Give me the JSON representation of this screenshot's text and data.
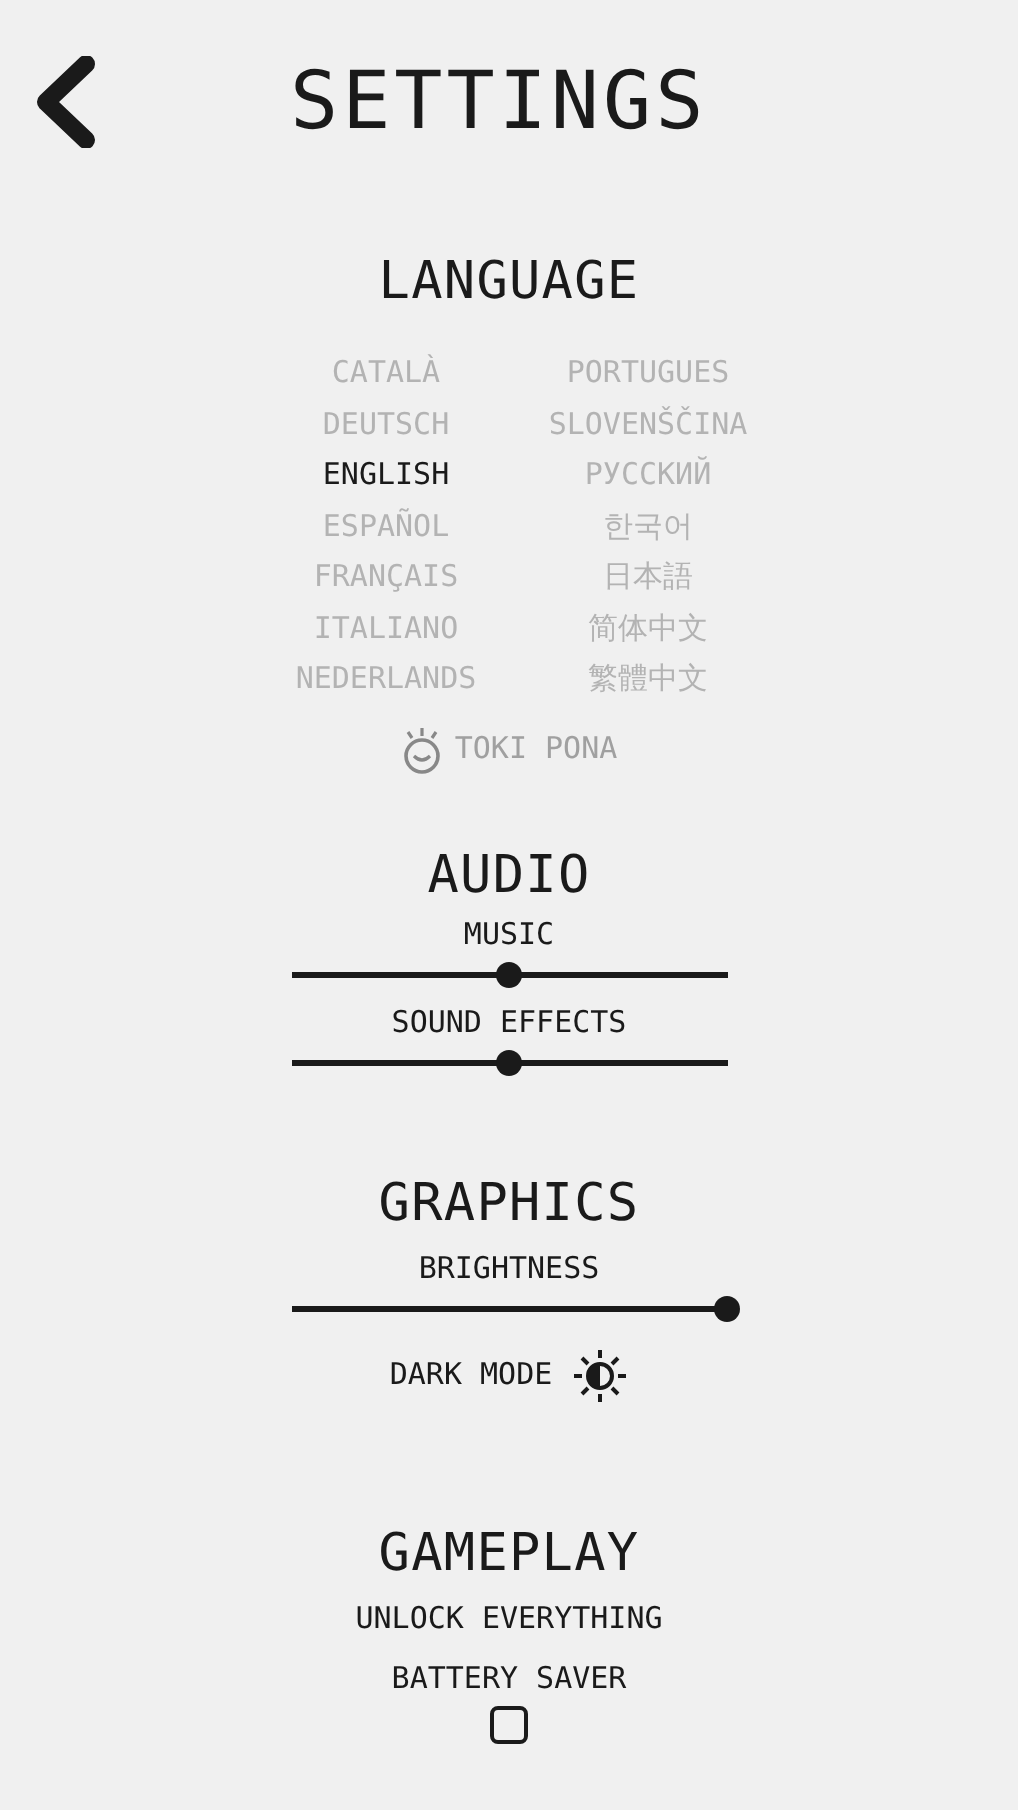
{
  "title": "SETTINGS",
  "language": {
    "heading": "LANGUAGE",
    "columns": [
      [
        {
          "label": "CATALÀ",
          "selected": false
        },
        {
          "label": "DEUTSCH",
          "selected": false
        },
        {
          "label": "ENGLISH",
          "selected": true
        },
        {
          "label": "ESPAÑOL",
          "selected": false
        },
        {
          "label": "FRANÇAIS",
          "selected": false
        },
        {
          "label": "ITALIANO",
          "selected": false
        },
        {
          "label": "NEDERLANDS",
          "selected": false
        }
      ],
      [
        {
          "label": "PORTUGUES",
          "selected": false
        },
        {
          "label": "SLOVENŠČINA",
          "selected": false
        },
        {
          "label": "РУССКИЙ",
          "selected": false
        },
        {
          "label": "한국어",
          "selected": false
        },
        {
          "label": "日本語",
          "selected": false
        },
        {
          "label": "简体中文",
          "selected": false
        },
        {
          "label": "繁體中文",
          "selected": false
        }
      ]
    ],
    "extra": {
      "label": "TOKI PONA",
      "selected": false
    }
  },
  "audio": {
    "heading": "AUDIO",
    "sliders": [
      {
        "label": "MUSIC",
        "level": 0.5
      },
      {
        "label": "SOUND EFFECTS",
        "level": 0.5
      }
    ]
  },
  "graphics": {
    "heading": "GRAPHICS",
    "sliders": [
      {
        "label": "BRIGHTNESS",
        "level": 1
      }
    ],
    "dark_mode": {
      "label": "DARK MODE"
    }
  },
  "gameplay": {
    "heading": "GAMEPLAY",
    "unlock": "UNLOCK EVERYTHING",
    "battery_saver": {
      "label": "BATTERY SAVER",
      "checked": false
    }
  }
}
